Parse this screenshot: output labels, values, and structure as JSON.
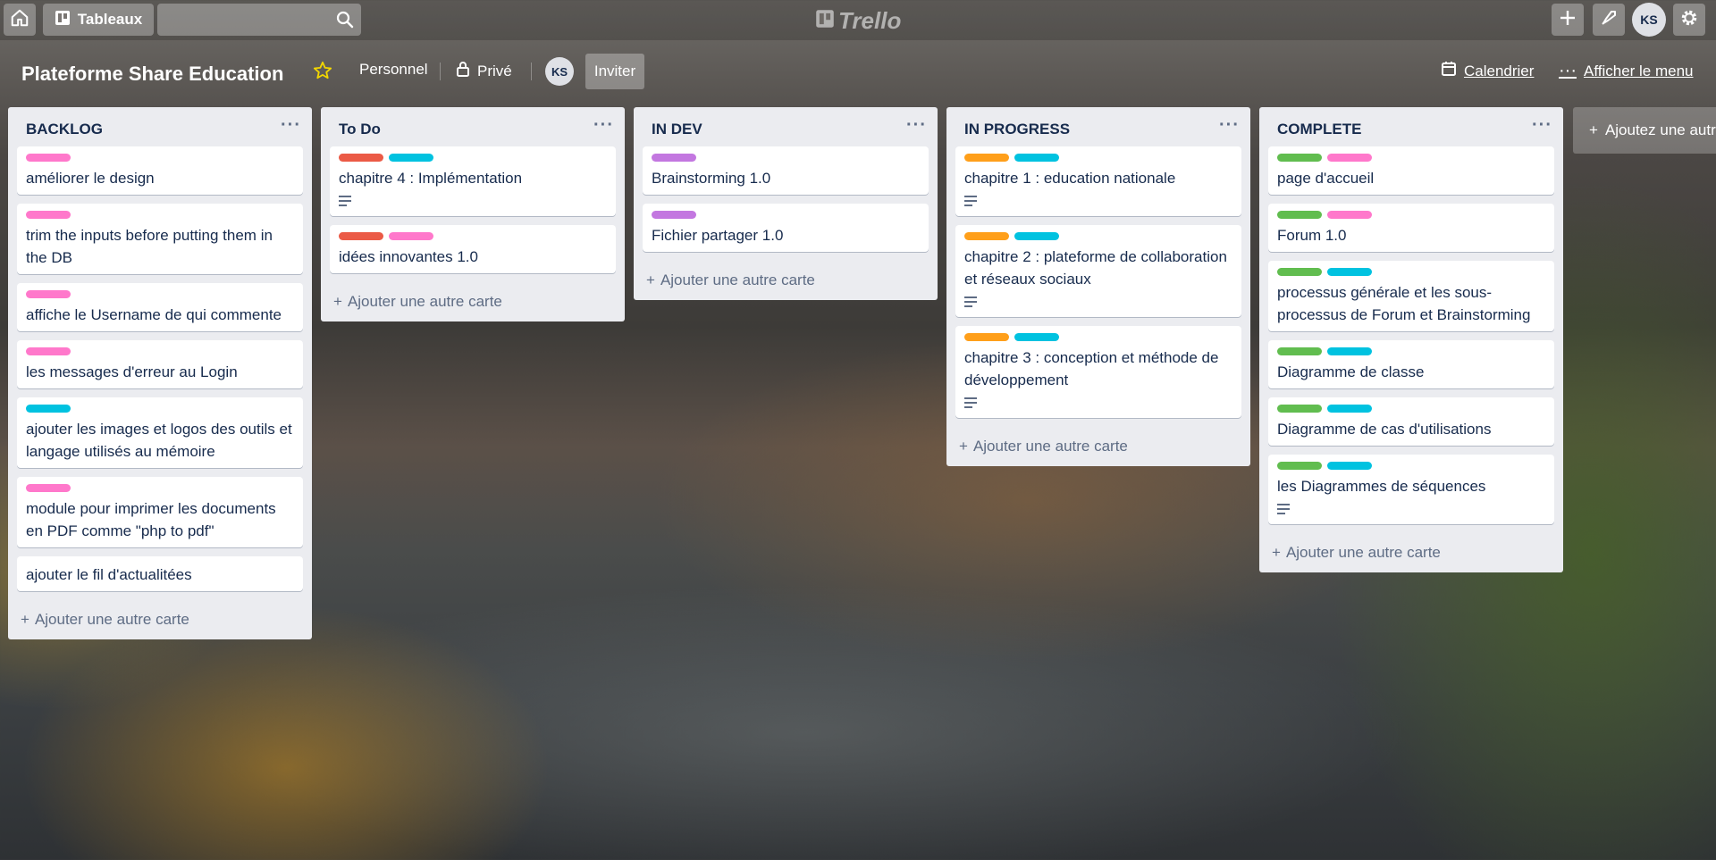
{
  "header": {
    "boards_label": "Tableaux",
    "logo_text": "Trello",
    "user_initials": "KS"
  },
  "board": {
    "title": "Plateforme Share Education",
    "team": "Personnel",
    "visibility": "Privé",
    "member_initials": "KS",
    "invite": "Inviter",
    "calendar": "Calendrier",
    "show_menu": "Afficher le menu",
    "add_card": "Ajouter une autre carte",
    "add_list": "Ajoutez une autre liste"
  },
  "colors": {
    "pink": "#ff78cb",
    "cyan": "#00c2e0",
    "red": "#eb5a46",
    "purple": "#c377e0",
    "orange": "#ff9f1a",
    "green": "#61bd4f"
  },
  "lists": [
    {
      "title": "BACKLOG",
      "cards": [
        {
          "labels": [
            "pink"
          ],
          "title": "améliorer le design",
          "desc": false
        },
        {
          "labels": [
            "pink"
          ],
          "title": "trim the inputs before putting them in the DB",
          "desc": false
        },
        {
          "labels": [
            "pink"
          ],
          "title": "affiche le Username de qui commente",
          "desc": false
        },
        {
          "labels": [
            "pink"
          ],
          "title": "les messages d'erreur au Login",
          "desc": false
        },
        {
          "labels": [
            "cyan"
          ],
          "title": "ajouter les images et logos des outils et langage utilisés au mémoire",
          "desc": false
        },
        {
          "labels": [
            "pink"
          ],
          "title": "module pour imprimer les documents en PDF comme \"php to pdf\"",
          "desc": false
        },
        {
          "labels": [],
          "title": "ajouter le fil d'actualitées",
          "desc": false
        }
      ]
    },
    {
      "title": "To Do",
      "cards": [
        {
          "labels": [
            "red",
            "cyan"
          ],
          "title": "chapitre 4 : Implémentation",
          "desc": true
        },
        {
          "labels": [
            "red",
            "pink"
          ],
          "title": "idées innovantes 1.0",
          "desc": false
        }
      ]
    },
    {
      "title": "IN DEV",
      "cards": [
        {
          "labels": [
            "purple"
          ],
          "title": "Brainstorming 1.0",
          "desc": false
        },
        {
          "labels": [
            "purple"
          ],
          "title": "Fichier partager 1.0",
          "desc": false
        }
      ]
    },
    {
      "title": "IN PROGRESS",
      "cards": [
        {
          "labels": [
            "orange",
            "cyan"
          ],
          "title": "chapitre 1 : education nationale",
          "desc": true
        },
        {
          "labels": [
            "orange",
            "cyan"
          ],
          "title": "chapitre 2 : plateforme de collaboration et réseaux sociaux",
          "desc": true
        },
        {
          "labels": [
            "orange",
            "cyan"
          ],
          "title": "chapitre 3 : conception et méthode de développement",
          "desc": true
        }
      ]
    },
    {
      "title": "COMPLETE",
      "cards": [
        {
          "labels": [
            "green",
            "pink"
          ],
          "title": "page d'accueil",
          "desc": false
        },
        {
          "labels": [
            "green",
            "pink"
          ],
          "title": "Forum 1.0",
          "desc": false
        },
        {
          "labels": [
            "green",
            "cyan"
          ],
          "title": "processus générale et les sous-processus de Forum et Brainstorming",
          "desc": false
        },
        {
          "labels": [
            "green",
            "cyan"
          ],
          "title": "Diagramme de classe",
          "desc": false
        },
        {
          "labels": [
            "green",
            "cyan"
          ],
          "title": "Diagramme de cas d'utilisations",
          "desc": false
        },
        {
          "labels": [
            "green",
            "cyan"
          ],
          "title": "les Diagrammes de séquences",
          "desc": true
        }
      ]
    }
  ]
}
